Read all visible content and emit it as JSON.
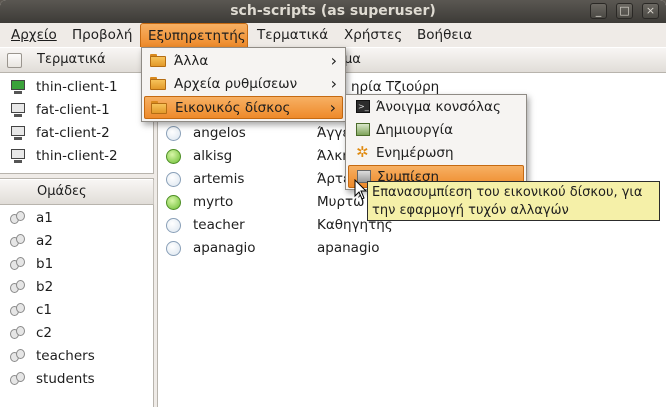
{
  "window": {
    "title": "sch-scripts (as superuser)",
    "controls": {
      "minimize": "_",
      "maximize": "□",
      "close": "×"
    }
  },
  "menubar": [
    "Αρχείο",
    "Προβολή",
    "Εξυπηρετητής",
    "Τερματικά",
    "Χρήστες",
    "Βοήθεια"
  ],
  "terminals": {
    "header": "Τερματικά",
    "items": [
      {
        "name": "thin-client-1",
        "online": true
      },
      {
        "name": "fat-client-1",
        "online": false
      },
      {
        "name": "fat-client-2",
        "online": false
      },
      {
        "name": "thin-client-2",
        "online": false
      }
    ]
  },
  "groups": {
    "header": "Ομάδες",
    "items": [
      "a1",
      "a2",
      "b1",
      "b2",
      "c1",
      "c2",
      "teachers",
      "students"
    ]
  },
  "users": {
    "header_partial": "μα",
    "first_row_fullname": "ηρία Τζιούρη",
    "rows": [
      {
        "username": "angelos",
        "fullname": "Άγγε",
        "online": false
      },
      {
        "username": "alkisg",
        "fullname": "Άλκη",
        "online": true
      },
      {
        "username": "artemis",
        "fullname": "Άρτε",
        "online": false
      },
      {
        "username": "myrto",
        "fullname": "Μυρτώ",
        "online": true
      },
      {
        "username": "teacher",
        "fullname": "Καθηγητής",
        "online": false
      },
      {
        "username": "apanagio",
        "fullname": "apanagio",
        "online": false
      }
    ]
  },
  "server_menu": {
    "items": [
      {
        "label": "Άλλα",
        "submenu": true
      },
      {
        "label": "Αρχεία ρυθμίσεων",
        "submenu": true
      },
      {
        "label": "Εικονικός δίσκος",
        "submenu": true
      }
    ]
  },
  "virtual_disk_menu": {
    "items": [
      {
        "label": "Άνοιγμα κονσόλας",
        "icon": "terminal-icon"
      },
      {
        "label": "Δημιουργία",
        "icon": "create-icon"
      },
      {
        "label": "Ενημέρωση",
        "icon": "update-gear-icon"
      },
      {
        "label": "Συμπίεση",
        "icon": "compress-icon"
      }
    ]
  },
  "tooltip": {
    "line1": "Επανασυμπίεση του εικονικού δίσκου, για",
    "line2": "την εφαρμογή τυχόν αλλαγών"
  },
  "colors": {
    "accent": "#ee8a2a",
    "titlebar": "#4a4843",
    "online": "#6bbd32"
  }
}
